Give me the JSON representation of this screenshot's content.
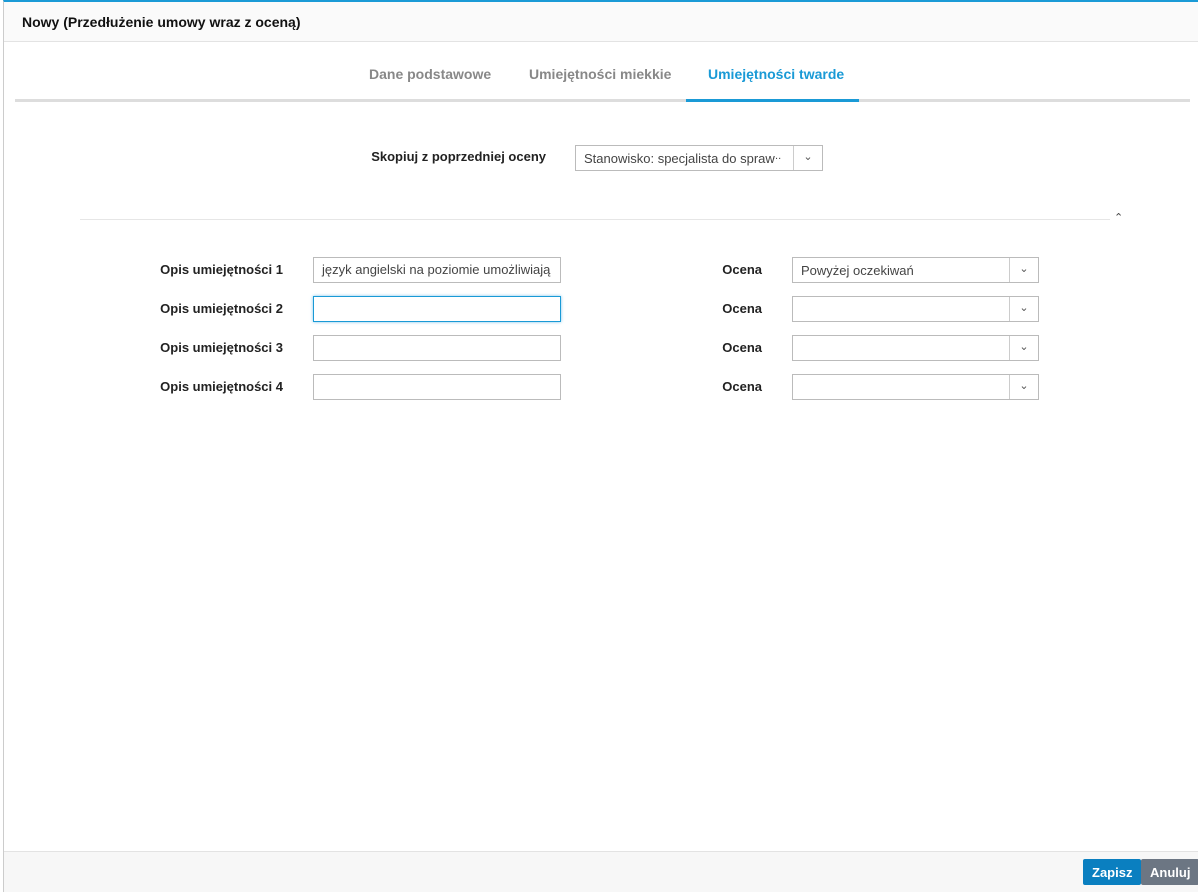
{
  "window": {
    "title": "Nowy (Przedłużenie umowy wraz z oceną)"
  },
  "tabs": [
    {
      "label": "Dane podstawowe"
    },
    {
      "label": "Umiejętności miekkie"
    },
    {
      "label": "Umiejętności twarde"
    }
  ],
  "copy": {
    "label": "Skopiuj z poprzedniej oceny",
    "value": "Stanowisko: specjalista do spraw",
    "ellipsis": "..."
  },
  "rows": [
    {
      "label": "Opis umiejętności 1",
      "value": "język angielski na poziomie umożliwiają",
      "rating_label": "Ocena",
      "rating": "Powyżej oczekiwań"
    },
    {
      "label": "Opis umiejętności 2",
      "value": "",
      "rating_label": "Ocena",
      "rating": ""
    },
    {
      "label": "Opis umiejętności 3",
      "value": "",
      "rating_label": "Ocena",
      "rating": ""
    },
    {
      "label": "Opis umiejętności 4",
      "value": "",
      "rating_label": "Ocena",
      "rating": ""
    }
  ],
  "footer": {
    "save": "Zapisz",
    "cancel": "Anuluj"
  },
  "colors": {
    "accent": "#1a9ad6",
    "save": "#0a7fc0",
    "cancel": "#6c7683"
  }
}
